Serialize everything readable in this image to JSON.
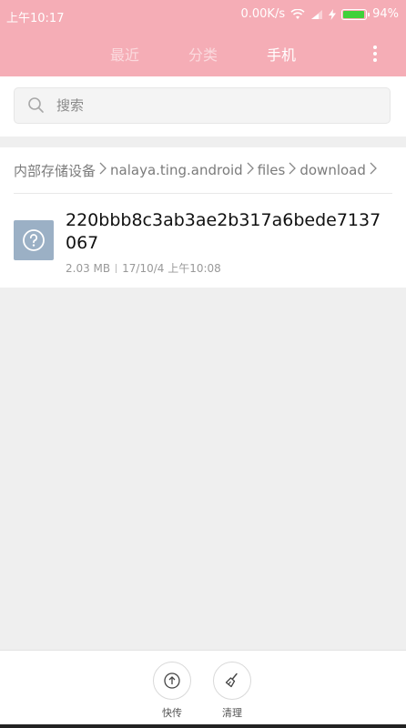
{
  "status_bar": {
    "time": "上午10:17",
    "network_speed": "0.00K/s",
    "battery": "94%",
    "battery_level": 0.94
  },
  "header": {
    "tabs": [
      {
        "label": "最近",
        "active": false
      },
      {
        "label": "分类",
        "active": false
      },
      {
        "label": "手机",
        "active": true
      }
    ]
  },
  "search": {
    "placeholder": "搜索"
  },
  "breadcrumb": {
    "items": [
      "内部存储设备",
      "nalaya.ting.android",
      "files",
      "download"
    ]
  },
  "files": [
    {
      "name": "220bbb8c3ab3ae2b317a6bede7137067",
      "size": "2.03 MB",
      "date": "17/10/4 上午10:08",
      "icon": "unknown-file-icon"
    }
  ],
  "bottom_bar": {
    "share_label": "快传",
    "clean_label": "清理"
  },
  "colors": {
    "accent": "#f5adb6",
    "file_icon_bg": "#9bb0c5",
    "battery_fill": "#3fd13a"
  }
}
